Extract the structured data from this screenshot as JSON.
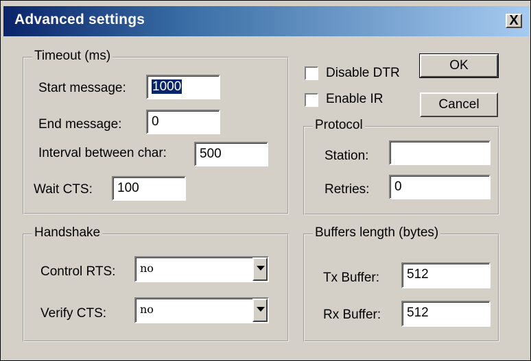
{
  "dialog": {
    "title": "Advanced settings",
    "close_label": "X"
  },
  "timeout": {
    "legend": "Timeout (ms)",
    "start_message_label": "Start message:",
    "start_message_value": "1000",
    "end_message_label": "End message:",
    "end_message_value": "0",
    "interval_label": "Interval between char:",
    "interval_value": "500",
    "wait_cts_label": "Wait CTS:",
    "wait_cts_value": "100"
  },
  "options": {
    "disable_dtr_label": "Disable DTR",
    "disable_dtr_checked": false,
    "enable_ir_label": "Enable IR",
    "enable_ir_checked": false
  },
  "buttons": {
    "ok_label": "OK",
    "cancel_label": "Cancel"
  },
  "protocol": {
    "legend": "Protocol",
    "station_label": "Station:",
    "station_value": "",
    "retries_label": "Retries:",
    "retries_value": "0"
  },
  "handshake": {
    "legend": "Handshake",
    "control_rts_label": "Control RTS:",
    "control_rts_value": "no",
    "verify_cts_label": "Verify CTS:",
    "verify_cts_value": "no"
  },
  "buffers": {
    "legend": "Buffers length (bytes)",
    "tx_label": "Tx Buffer:",
    "tx_value": "512",
    "rx_label": "Rx Buffer:",
    "rx_value": "512"
  }
}
